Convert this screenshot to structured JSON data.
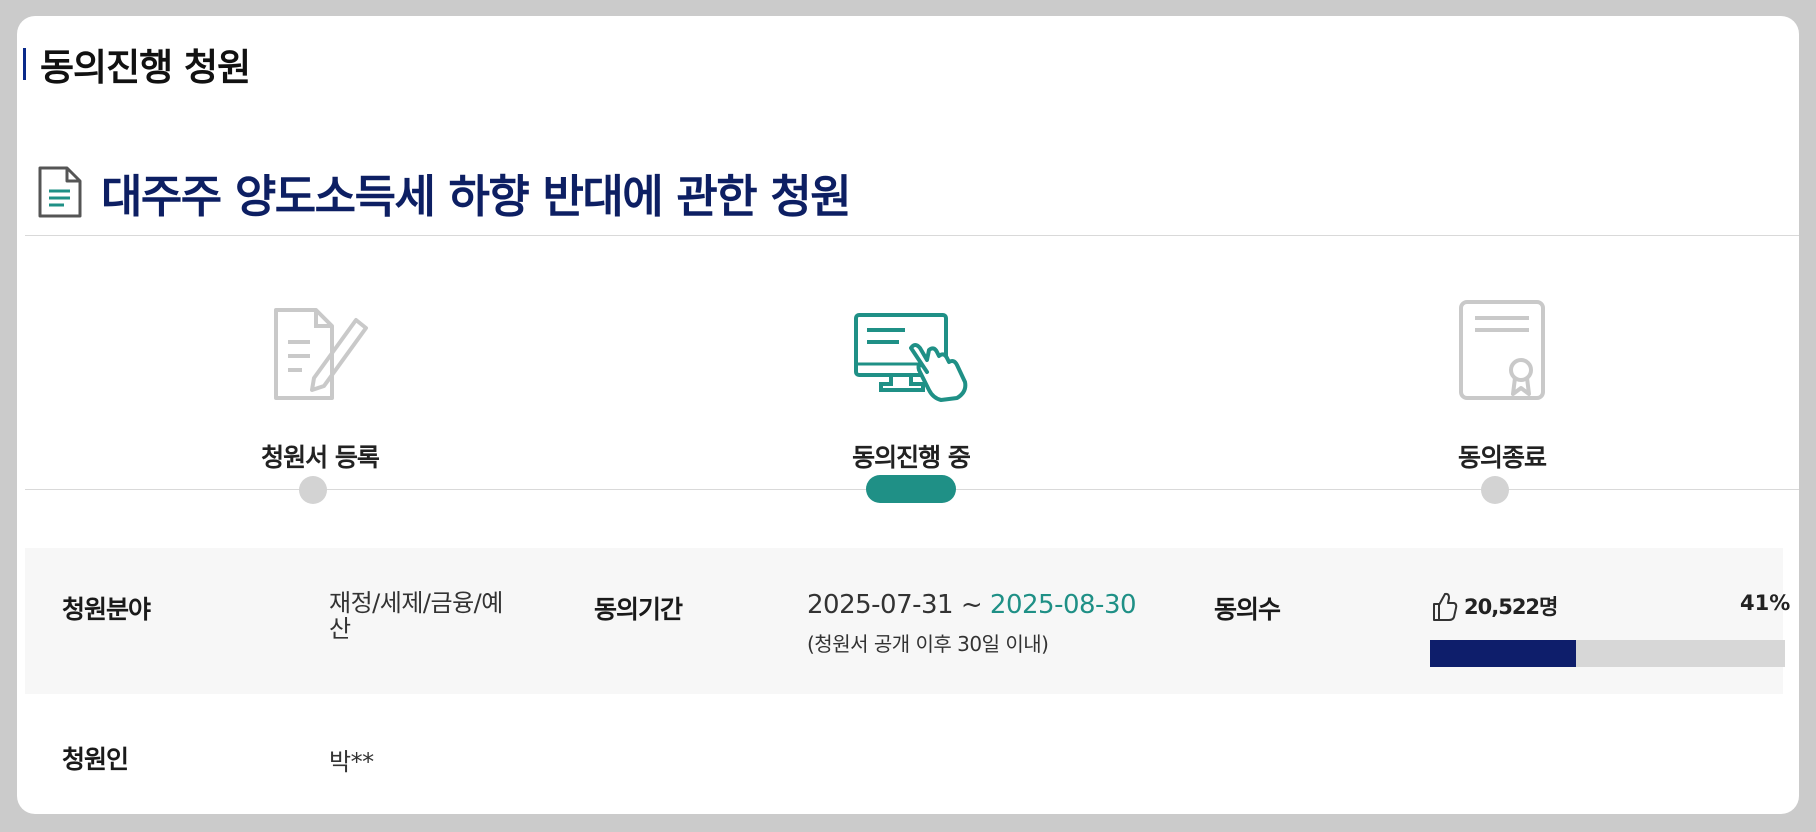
{
  "section": {
    "title": "동의진행 청원"
  },
  "petition": {
    "title": "대주주 양도소득세 하향 반대에 관한 청원"
  },
  "steps": [
    {
      "label": "청원서 등록",
      "icon": "document-pen-icon",
      "state": "done"
    },
    {
      "label": "동의진행 중",
      "icon": "monitor-hand-icon",
      "state": "active"
    },
    {
      "label": "동의종료",
      "icon": "certificate-icon",
      "state": "pending"
    }
  ],
  "info": {
    "field_label": "청원분야",
    "field_value_line1": "재정/세제/금융/예",
    "field_value_line2": "산",
    "period_label": "동의기간",
    "period_start": "2025-07-31 ~ ",
    "period_end": "2025-08-30",
    "period_note": "(청원서 공개 이후 30일 이내)",
    "count_label": "동의수",
    "count_value": "20,522명",
    "percent_text": "41%",
    "progress_fraction": 0.41,
    "petitioner_label": "청원인",
    "petitioner_value": "박**"
  },
  "colors": {
    "accent_teal": "#1f9086",
    "title_navy": "#0d1f63",
    "progress_fill": "#0e1e6b",
    "progress_track": "#d7d7d7"
  }
}
